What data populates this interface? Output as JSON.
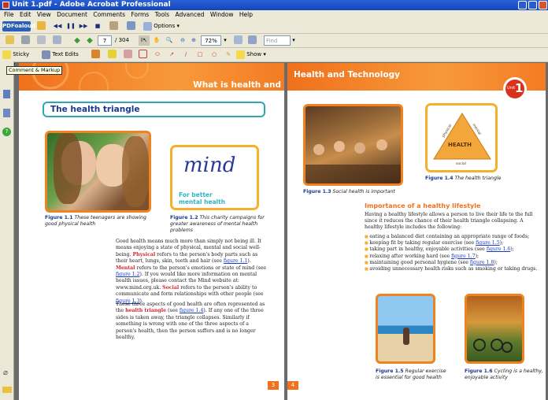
{
  "window": {
    "title": "Unit 1.pdf - Adobe Acrobat Professional"
  },
  "menu": [
    "File",
    "Edit",
    "View",
    "Document",
    "Comments",
    "Forms",
    "Tools",
    "Advanced",
    "Window",
    "Help"
  ],
  "toolbar1": {
    "brand": "PDFoaloud",
    "options": "Options"
  },
  "toolbar2": {
    "page_current": "7",
    "page_total": "/ 304",
    "zoom": "72%",
    "find_placeholder": "Find"
  },
  "toolbar3": {
    "sticky_note": "Sticky Note",
    "text_edits": "Text Edits",
    "show": "Show"
  },
  "tooltip": "Comment & Markup",
  "page3": {
    "heading": "What is health and technology?",
    "section_title": "The health triangle",
    "fig1_label": "Figure 1.1",
    "fig1_caption": "These teenagers are showing good physical health",
    "fig2_label": "Figure 1.2",
    "fig2_caption": "This charity campaigns for greater awareness of mental health problems",
    "mind_logo": "mind",
    "mind_tag": "For better mental health",
    "para1": [
      {
        "t": "Good health means much more than simply not being ill. It means enjoying a state of physical, mental and social well-being. "
      },
      {
        "t": "Physical",
        "c": "red"
      },
      {
        "t": " refers to the person's body parts such as their heart, lungs, skin, teeth and hair (see "
      },
      {
        "t": "figure 1.1",
        "c": "lnk"
      },
      {
        "t": "). "
      },
      {
        "t": "Mental",
        "c": "red"
      },
      {
        "t": " refers to the person's emotions or state of mind (see "
      },
      {
        "t": "figure 1.2",
        "c": "lnk"
      },
      {
        "t": "). If you would like more information on mental health issues, please contact the Mind website at: www.mind.org.uk. "
      },
      {
        "t": "Social",
        "c": "red"
      },
      {
        "t": " refers to the person's ability to communicate and form relationships with other people (see "
      },
      {
        "t": "figure 1.3",
        "c": "lnk"
      },
      {
        "t": ")."
      }
    ],
    "para2": [
      {
        "t": "These three aspects of good health are often represented as the "
      },
      {
        "t": "health triangle",
        "c": "red"
      },
      {
        "t": " (see "
      },
      {
        "t": "figure 1.4",
        "c": "lnk"
      },
      {
        "t": "). If any one of the three sides is taken away, the triangle collapses. Similarly if something is wrong with one of the three aspects of a person's health, then the person suffers and is no longer healthy."
      }
    ],
    "page_number": "3"
  },
  "page4": {
    "heading": "Health and Technology",
    "unit_label": "Unit",
    "unit_number": "1",
    "fig3_label": "Figure 1.3",
    "fig3_caption": "Social health is important",
    "fig4_label": "Figure 1.4",
    "fig4_caption": "The health triangle",
    "triangle": {
      "center": "HEALTH",
      "left": "physical",
      "right": "mental",
      "bottom": "social"
    },
    "section_title": "Importance of a healthy lifestyle",
    "intro": "Having a healthy lifestyle allows a person to live their life to the full since it reduces the chance of their health triangle collapsing. A healthy lifestyle includes the following:",
    "bullets": [
      [
        {
          "t": "eating a balanced diet containing an appropriate range of foods;"
        }
      ],
      [
        {
          "t": "keeping fit by taking regular exercise (see "
        },
        {
          "t": "figure 1.5",
          "c": "lnk"
        },
        {
          "t": ");"
        }
      ],
      [
        {
          "t": "taking part in healthy, enjoyable activities (see "
        },
        {
          "t": "figure 1.6",
          "c": "lnk"
        },
        {
          "t": ");"
        }
      ],
      [
        {
          "t": "relaxing after working hard (see "
        },
        {
          "t": "figure 1.7",
          "c": "lnk"
        },
        {
          "t": ");"
        }
      ],
      [
        {
          "t": "maintaining good personal hygiene (see "
        },
        {
          "t": "figure 1.8",
          "c": "lnk"
        },
        {
          "t": ");"
        }
      ],
      [
        {
          "t": "avoiding unnecessary health risks such as smoking or taking drugs."
        }
      ]
    ],
    "fig5_label": "Figure 1.5",
    "fig5_caption": "Regular exercise is essential for good health",
    "fig6_label": "Figure 1.6",
    "fig6_caption": "Cycling is a healthy, enjoyable activity",
    "page_number": "4"
  },
  "colors": {
    "title_bar": "#2457d2",
    "menu_bg": "#ece9d8",
    "orange": "#f47b23",
    "teal": "#1aa0a5",
    "heading_blue": "#1a3a8e",
    "red_term": "#d2282f"
  }
}
